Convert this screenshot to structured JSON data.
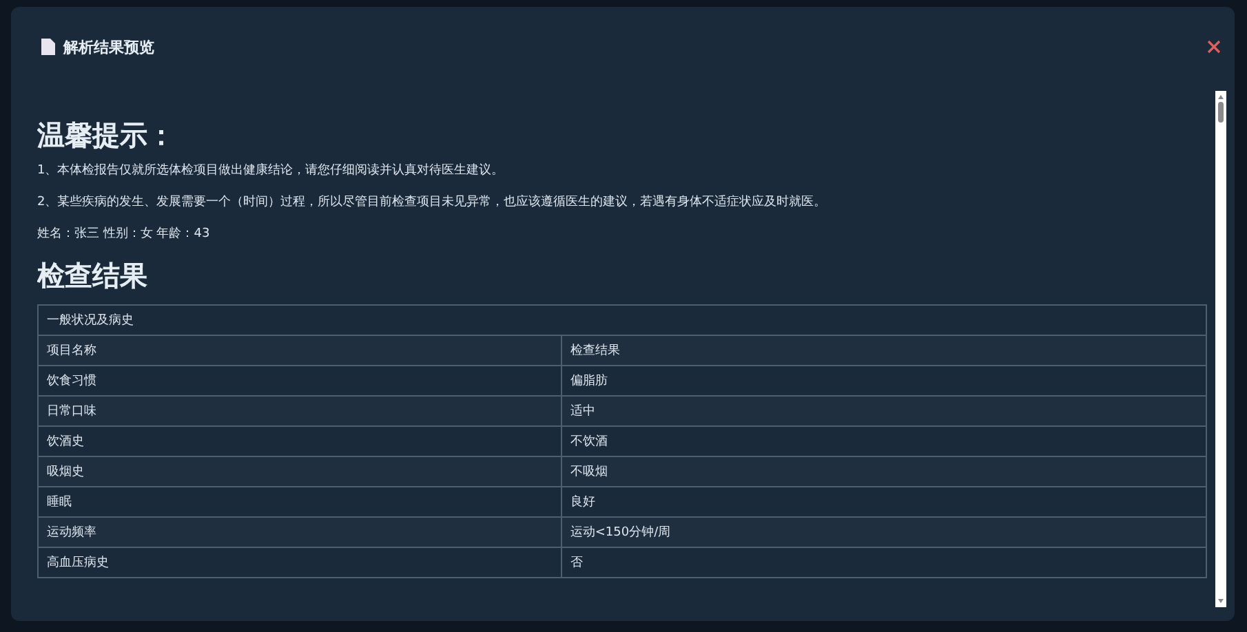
{
  "dialog": {
    "title": "解析结果预览"
  },
  "notice": {
    "heading": "温馨提示：",
    "lines": [
      "1、本体检报告仅就所选体检项目做出健康结论，请您仔细阅读并认真对待医生建议。",
      "2、某些疾病的发生、发展需要一个（时间）过程，所以尽管目前检查项目未见异常，也应该遵循医生的建议，若遇有身体不适症状应及时就医。"
    ],
    "patient": "姓名：张三 性别：女 年龄：43"
  },
  "results": {
    "heading": "检查结果",
    "section": "一般状况及病史",
    "columns": [
      "项目名称",
      "检查结果"
    ],
    "rows": [
      {
        "item": "饮食习惯",
        "result": "偏脂肪"
      },
      {
        "item": "日常口味",
        "result": "适中"
      },
      {
        "item": "饮酒史",
        "result": "不饮酒"
      },
      {
        "item": "吸烟史",
        "result": "不吸烟"
      },
      {
        "item": "睡眠",
        "result": "良好"
      },
      {
        "item": "运动频率",
        "result": "运动<150分钟/周"
      },
      {
        "item": "高血压病史",
        "result": "否"
      }
    ]
  }
}
